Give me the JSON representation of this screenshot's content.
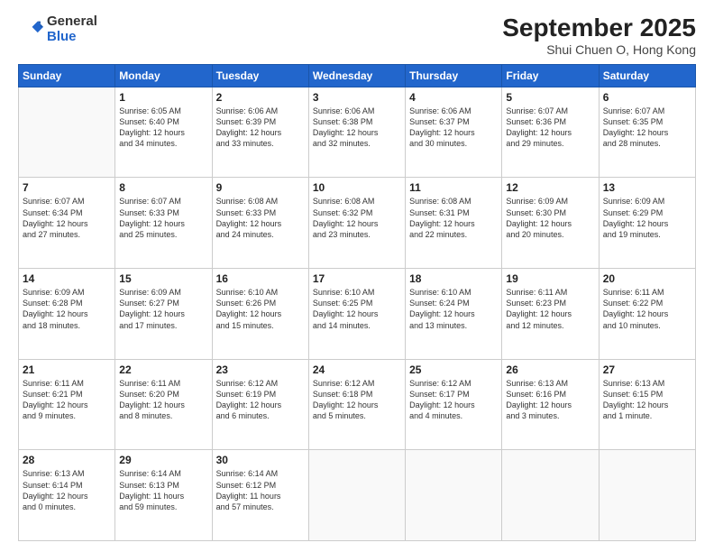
{
  "logo": {
    "general": "General",
    "blue": "Blue"
  },
  "title": {
    "month": "September 2025",
    "location": "Shui Chuen O, Hong Kong"
  },
  "days_header": [
    "Sunday",
    "Monday",
    "Tuesday",
    "Wednesday",
    "Thursday",
    "Friday",
    "Saturday"
  ],
  "weeks": [
    [
      {
        "day": "",
        "info": ""
      },
      {
        "day": "1",
        "info": "Sunrise: 6:05 AM\nSunset: 6:40 PM\nDaylight: 12 hours\nand 34 minutes."
      },
      {
        "day": "2",
        "info": "Sunrise: 6:06 AM\nSunset: 6:39 PM\nDaylight: 12 hours\nand 33 minutes."
      },
      {
        "day": "3",
        "info": "Sunrise: 6:06 AM\nSunset: 6:38 PM\nDaylight: 12 hours\nand 32 minutes."
      },
      {
        "day": "4",
        "info": "Sunrise: 6:06 AM\nSunset: 6:37 PM\nDaylight: 12 hours\nand 30 minutes."
      },
      {
        "day": "5",
        "info": "Sunrise: 6:07 AM\nSunset: 6:36 PM\nDaylight: 12 hours\nand 29 minutes."
      },
      {
        "day": "6",
        "info": "Sunrise: 6:07 AM\nSunset: 6:35 PM\nDaylight: 12 hours\nand 28 minutes."
      }
    ],
    [
      {
        "day": "7",
        "info": "Sunrise: 6:07 AM\nSunset: 6:34 PM\nDaylight: 12 hours\nand 27 minutes."
      },
      {
        "day": "8",
        "info": "Sunrise: 6:07 AM\nSunset: 6:33 PM\nDaylight: 12 hours\nand 25 minutes."
      },
      {
        "day": "9",
        "info": "Sunrise: 6:08 AM\nSunset: 6:33 PM\nDaylight: 12 hours\nand 24 minutes."
      },
      {
        "day": "10",
        "info": "Sunrise: 6:08 AM\nSunset: 6:32 PM\nDaylight: 12 hours\nand 23 minutes."
      },
      {
        "day": "11",
        "info": "Sunrise: 6:08 AM\nSunset: 6:31 PM\nDaylight: 12 hours\nand 22 minutes."
      },
      {
        "day": "12",
        "info": "Sunrise: 6:09 AM\nSunset: 6:30 PM\nDaylight: 12 hours\nand 20 minutes."
      },
      {
        "day": "13",
        "info": "Sunrise: 6:09 AM\nSunset: 6:29 PM\nDaylight: 12 hours\nand 19 minutes."
      }
    ],
    [
      {
        "day": "14",
        "info": "Sunrise: 6:09 AM\nSunset: 6:28 PM\nDaylight: 12 hours\nand 18 minutes."
      },
      {
        "day": "15",
        "info": "Sunrise: 6:09 AM\nSunset: 6:27 PM\nDaylight: 12 hours\nand 17 minutes."
      },
      {
        "day": "16",
        "info": "Sunrise: 6:10 AM\nSunset: 6:26 PM\nDaylight: 12 hours\nand 15 minutes."
      },
      {
        "day": "17",
        "info": "Sunrise: 6:10 AM\nSunset: 6:25 PM\nDaylight: 12 hours\nand 14 minutes."
      },
      {
        "day": "18",
        "info": "Sunrise: 6:10 AM\nSunset: 6:24 PM\nDaylight: 12 hours\nand 13 minutes."
      },
      {
        "day": "19",
        "info": "Sunrise: 6:11 AM\nSunset: 6:23 PM\nDaylight: 12 hours\nand 12 minutes."
      },
      {
        "day": "20",
        "info": "Sunrise: 6:11 AM\nSunset: 6:22 PM\nDaylight: 12 hours\nand 10 minutes."
      }
    ],
    [
      {
        "day": "21",
        "info": "Sunrise: 6:11 AM\nSunset: 6:21 PM\nDaylight: 12 hours\nand 9 minutes."
      },
      {
        "day": "22",
        "info": "Sunrise: 6:11 AM\nSunset: 6:20 PM\nDaylight: 12 hours\nand 8 minutes."
      },
      {
        "day": "23",
        "info": "Sunrise: 6:12 AM\nSunset: 6:19 PM\nDaylight: 12 hours\nand 6 minutes."
      },
      {
        "day": "24",
        "info": "Sunrise: 6:12 AM\nSunset: 6:18 PM\nDaylight: 12 hours\nand 5 minutes."
      },
      {
        "day": "25",
        "info": "Sunrise: 6:12 AM\nSunset: 6:17 PM\nDaylight: 12 hours\nand 4 minutes."
      },
      {
        "day": "26",
        "info": "Sunrise: 6:13 AM\nSunset: 6:16 PM\nDaylight: 12 hours\nand 3 minutes."
      },
      {
        "day": "27",
        "info": "Sunrise: 6:13 AM\nSunset: 6:15 PM\nDaylight: 12 hours\nand 1 minute."
      }
    ],
    [
      {
        "day": "28",
        "info": "Sunrise: 6:13 AM\nSunset: 6:14 PM\nDaylight: 12 hours\nand 0 minutes."
      },
      {
        "day": "29",
        "info": "Sunrise: 6:14 AM\nSunset: 6:13 PM\nDaylight: 11 hours\nand 59 minutes."
      },
      {
        "day": "30",
        "info": "Sunrise: 6:14 AM\nSunset: 6:12 PM\nDaylight: 11 hours\nand 57 minutes."
      },
      {
        "day": "",
        "info": ""
      },
      {
        "day": "",
        "info": ""
      },
      {
        "day": "",
        "info": ""
      },
      {
        "day": "",
        "info": ""
      }
    ]
  ]
}
